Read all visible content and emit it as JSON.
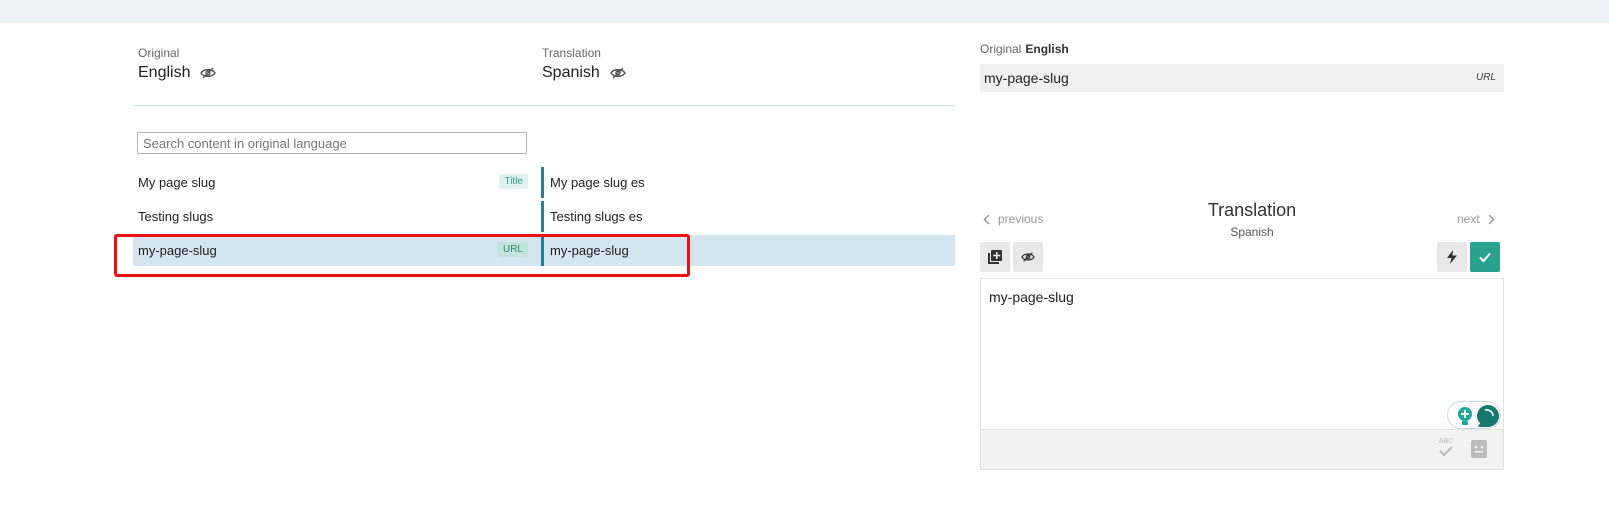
{
  "header": {
    "original_caption": "Original",
    "original_language": "English",
    "translation_caption": "Translation",
    "translation_language": "Spanish"
  },
  "search": {
    "placeholder": "Search content in original language"
  },
  "rows": [
    {
      "original": "My page slug",
      "tag": "Title",
      "translation": "My page slug es",
      "selected": false
    },
    {
      "original": "Testing slugs",
      "tag": "",
      "translation": "Testing slugs es",
      "selected": false
    },
    {
      "original": "my-page-slug",
      "tag": "URL",
      "translation": "my-page-slug",
      "selected": true
    }
  ],
  "right_panel": {
    "original_caption": "Original",
    "original_language": "English",
    "original_value": "my-page-slug",
    "original_type": "URL",
    "prev_label": "previous",
    "next_label": "next",
    "title": "Translation",
    "subtitle": "Spanish",
    "editor_value": "my-page-slug",
    "spell_label": "ABC"
  },
  "colors": {
    "accent": "#2aa28d",
    "row_selected": "#d4e5ef",
    "row_bar": "#2a7c9c",
    "highlight": "#ee1111"
  },
  "icons": {
    "visibility": "eye-off-icon",
    "copy": "copy-source-icon",
    "auto": "lightning-icon",
    "confirm": "check-icon",
    "spellcheck": "spellcheck-icon",
    "dictionary": "dictionary-icon",
    "hint": "lightbulb-icon",
    "chat": "chat-icon"
  }
}
